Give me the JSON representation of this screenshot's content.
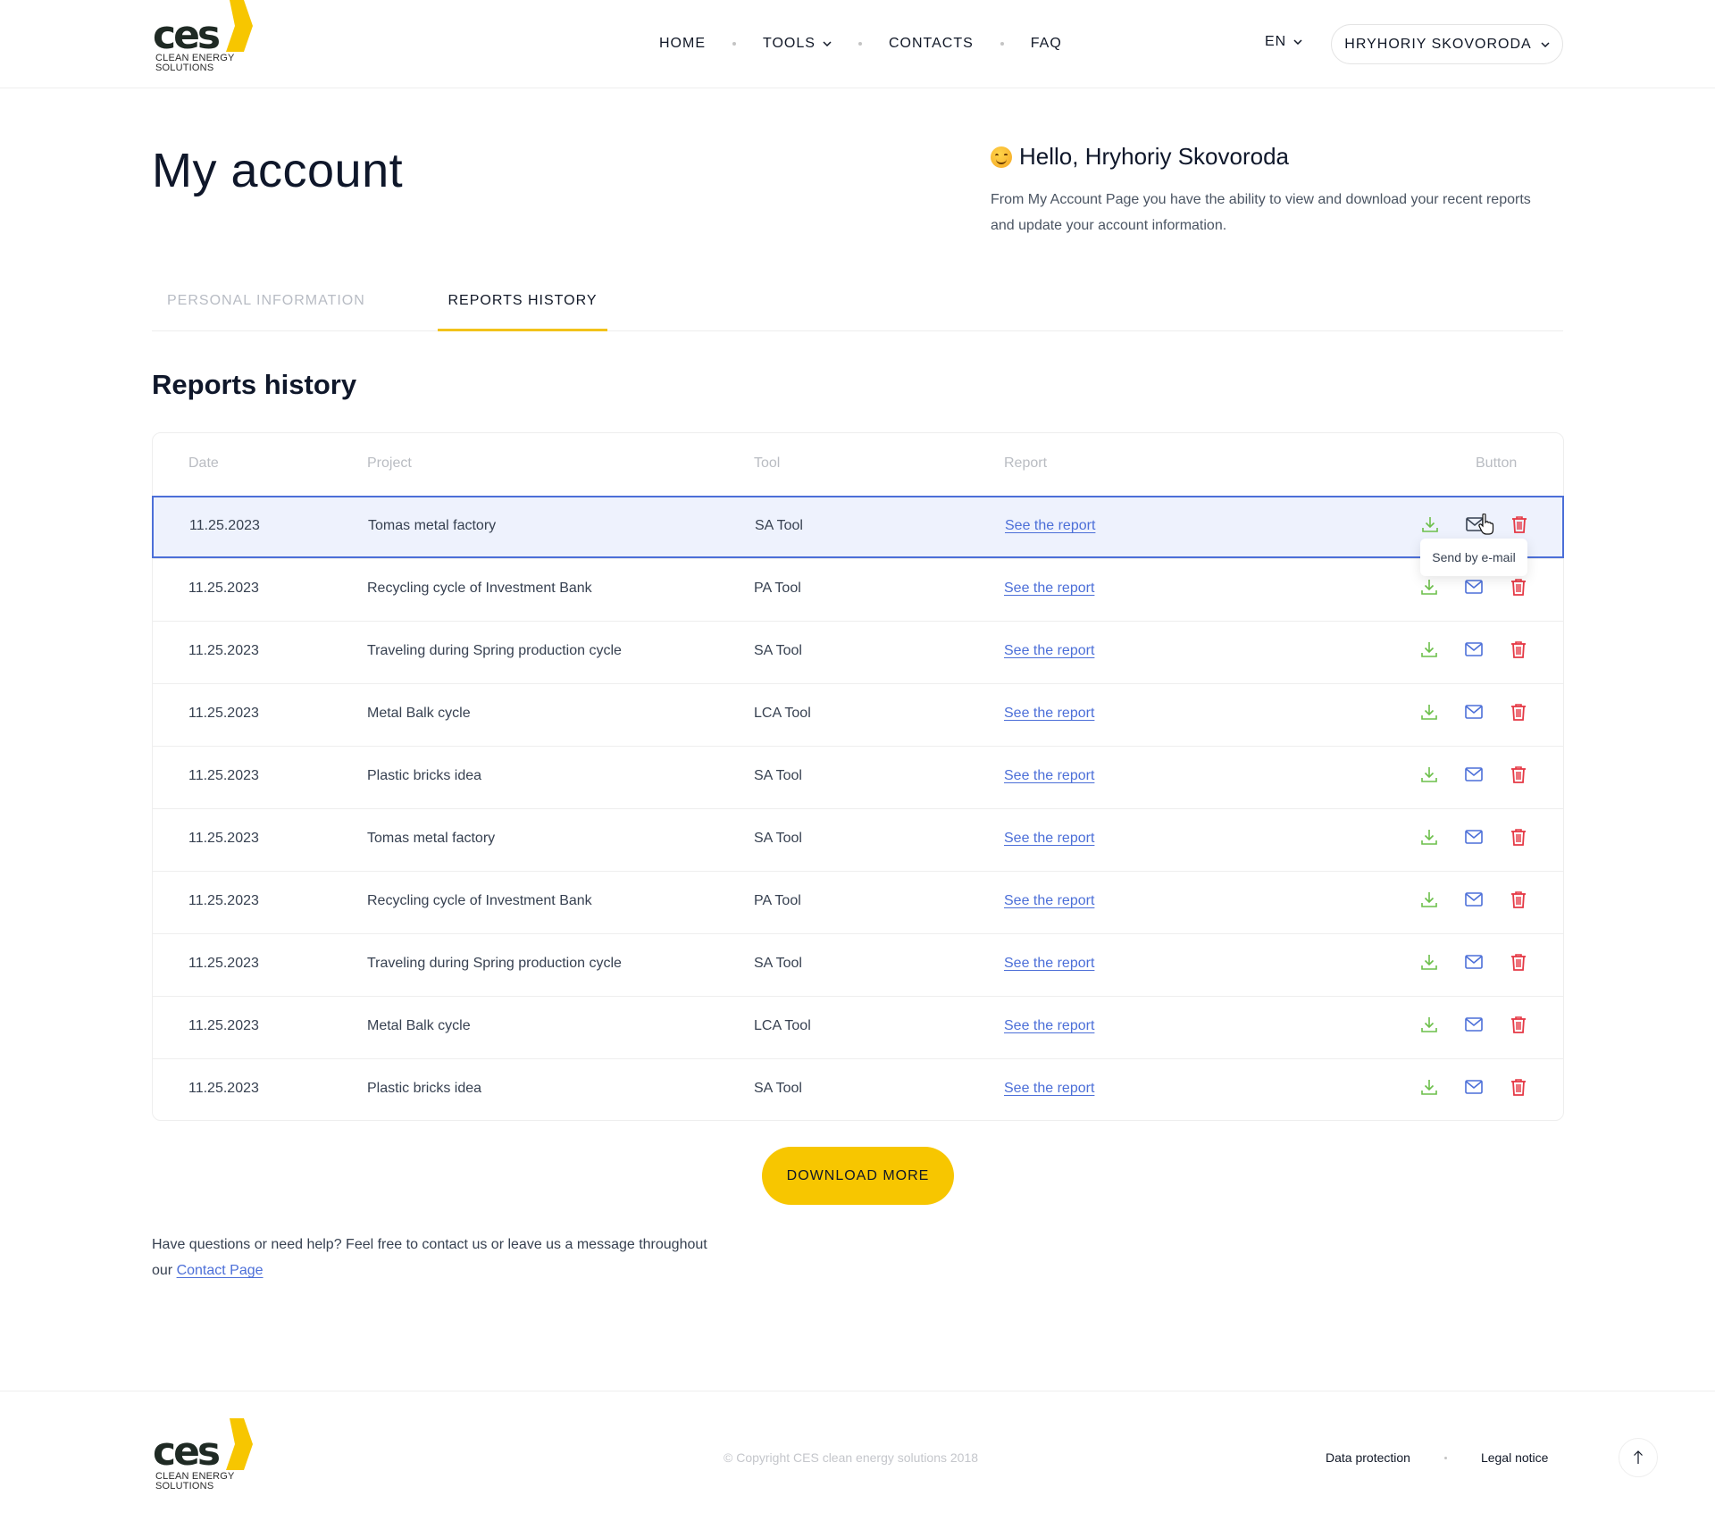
{
  "brand": {
    "logo_text": "ces",
    "logo_subtitle_line1": "CLEAN ENERGY",
    "logo_subtitle_line2": "SOLUTIONS",
    "accent_color": "#f7c600",
    "link_color": "#4c6fd8"
  },
  "nav": {
    "items": [
      {
        "label": "HOME",
        "has_dropdown": false
      },
      {
        "label": "TOOLS",
        "has_dropdown": true
      },
      {
        "label": "CONTACTS",
        "has_dropdown": false
      },
      {
        "label": "FAQ",
        "has_dropdown": false
      }
    ],
    "language": "EN",
    "user_name": "HRYHORIY SKOVORODA"
  },
  "hero": {
    "title": "My account",
    "greeting": "Hello, Hryhoriy Skovoroda",
    "greeting_icon": "smiling-face-emoji",
    "intro": "From My Account Page you have the ability to view and download your recent reports and update your account information."
  },
  "tabs": [
    {
      "label": "PERSONAL INFORMATION",
      "active": false
    },
    {
      "label": "REPORTS HISTORY",
      "active": true
    }
  ],
  "reports": {
    "title": "Reports history",
    "columns": [
      "Date",
      "Project",
      "Tool",
      "Report",
      "Button"
    ],
    "rows": [
      {
        "date": "11.25.2023",
        "project": "Tomas metal factory",
        "tool": "SA Tool",
        "report": "See the report",
        "highlighted": true
      },
      {
        "date": "11.25.2023",
        "project": "Recycling cycle of Investment Bank",
        "tool": "PA Tool",
        "report": "See the report"
      },
      {
        "date": "11.25.2023",
        "project": "Traveling during Spring production cycle",
        "tool": "SA Tool",
        "report": "See the report"
      },
      {
        "date": "11.25.2023",
        "project": "Metal Balk cycle",
        "tool": "LCA Tool",
        "report": "See the report"
      },
      {
        "date": "11.25.2023",
        "project": "Plastic bricks idea",
        "tool": "SA Tool",
        "report": "See the report"
      },
      {
        "date": "11.25.2023",
        "project": "Tomas metal factory",
        "tool": "SA Tool",
        "report": "See the report"
      },
      {
        "date": "11.25.2023",
        "project": "Recycling cycle of Investment Bank",
        "tool": "PA Tool",
        "report": "See the report"
      },
      {
        "date": "11.25.2023",
        "project": "Traveling during Spring production cycle",
        "tool": "SA Tool",
        "report": "See the report"
      },
      {
        "date": "11.25.2023",
        "project": "Metal Balk cycle",
        "tool": "LCA Tool",
        "report": "See the report"
      },
      {
        "date": "11.25.2023",
        "project": "Plastic bricks idea",
        "tool": "SA Tool",
        "report": "See the report"
      }
    ],
    "actions": [
      {
        "icon": "download-icon",
        "color": "#6cbf4a"
      },
      {
        "icon": "mail-icon",
        "color": "#4c6fd8"
      },
      {
        "icon": "trash-icon",
        "color": "#e53945"
      }
    ],
    "tooltip": "Send by e-mail",
    "download_more_label": "DOWNLOAD MORE"
  },
  "help": {
    "text": "Have questions or need help? Feel free to contact us or leave us a message throughout our",
    "link_label": "Contact Page"
  },
  "footer": {
    "copyright": "© Copyright CES clean energy solutions 2018",
    "links": [
      "Data protection",
      "Legal notice"
    ],
    "scroll_top_icon": "arrow-up-icon"
  }
}
